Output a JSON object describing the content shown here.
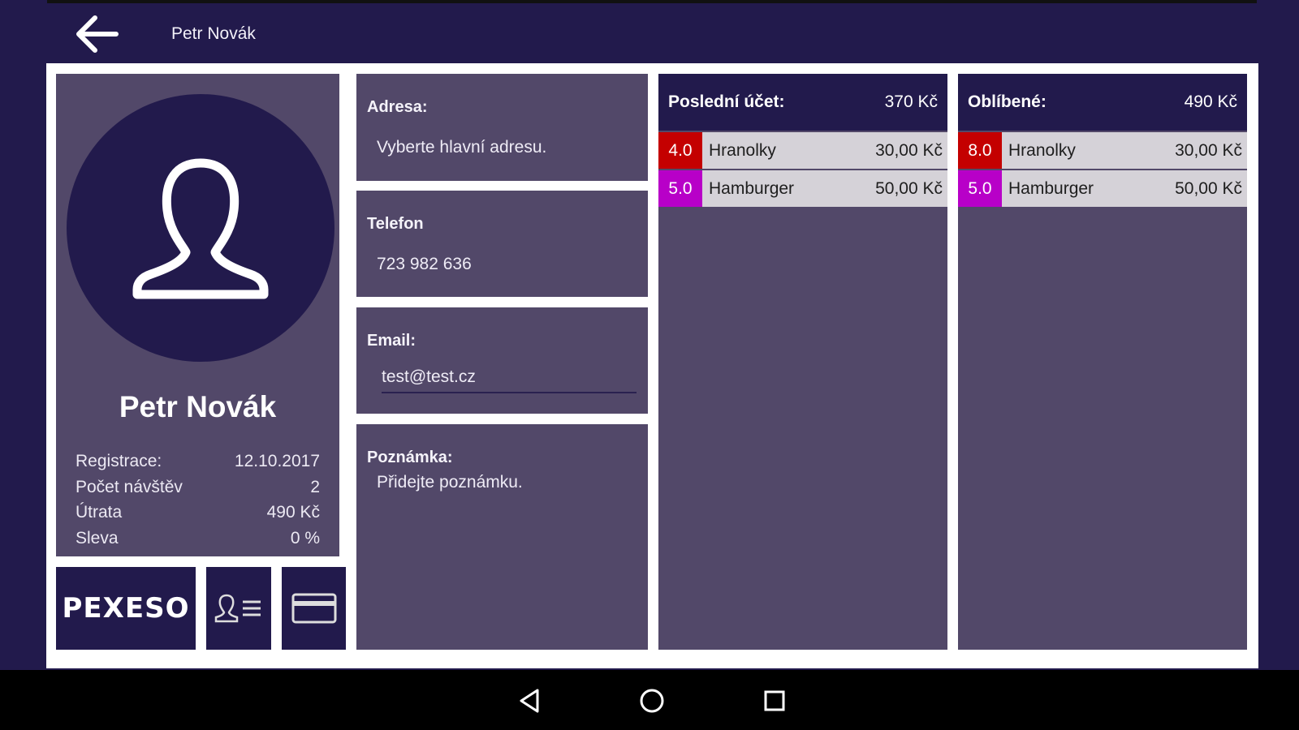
{
  "header": {
    "title": "Petr Novák"
  },
  "profile": {
    "name": "Petr Novák",
    "stats": [
      {
        "label": "Registrace:",
        "value": "12.10.2017"
      },
      {
        "label": "Počet návštěv",
        "value": "2"
      },
      {
        "label": "Útrata",
        "value": "490 Kč"
      },
      {
        "label": "Sleva",
        "value": "0 %"
      }
    ]
  },
  "tiles": {
    "pexeso_label": "PEXESO"
  },
  "info": {
    "address": {
      "label": "Adresa:",
      "value": "Vyberte hlavní adresu."
    },
    "phone": {
      "label": "Telefon",
      "value": "723 982 636"
    },
    "email": {
      "label": "Email:",
      "value": "test@test.cz"
    },
    "note": {
      "label": "Poznámka:",
      "value": "Přidejte poznámku."
    }
  },
  "last_order": {
    "label": "Poslední účet:",
    "total": "370 Kč",
    "items": [
      {
        "qty": "4.0",
        "name": "Hranolky",
        "price": "30,00 Kč",
        "color": "#c40000"
      },
      {
        "qty": "5.0",
        "name": "Hamburger",
        "price": "50,00 Kč",
        "color": "#b800c8"
      }
    ]
  },
  "favorites": {
    "label": "Oblíbené:",
    "total": "490 Kč",
    "items": [
      {
        "qty": "8.0",
        "name": "Hranolky",
        "price": "30,00 Kč",
        "color": "#c40000"
      },
      {
        "qty": "5.0",
        "name": "Hamburger",
        "price": "50,00 Kč",
        "color": "#b800c8"
      }
    ]
  },
  "colors": {
    "background": "#221a4c",
    "panel": "#524869",
    "item_row": "#d5d2d8"
  },
  "icons": {
    "back": "arrow-left-icon",
    "avatar": "user-silhouette-icon",
    "customer_list": "user-list-icon",
    "card": "credit-card-icon",
    "nav_back": "triangle-back-icon",
    "nav_home": "circle-home-icon",
    "nav_recents": "square-recents-icon"
  }
}
